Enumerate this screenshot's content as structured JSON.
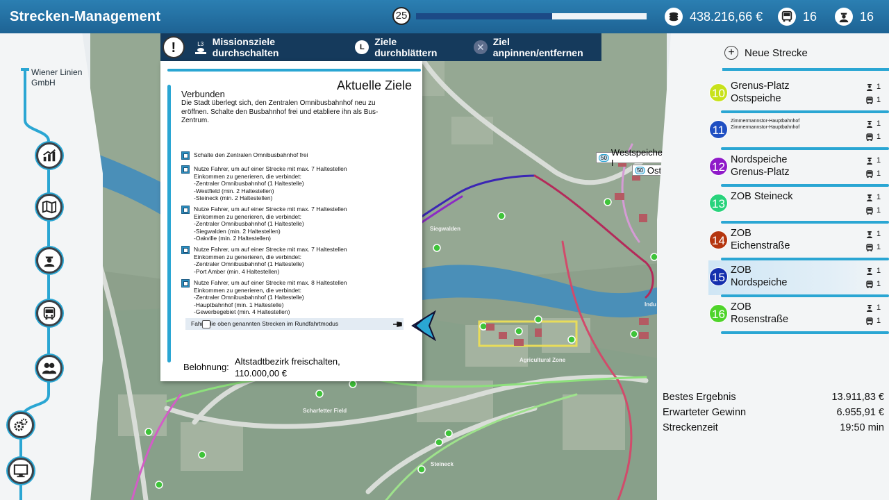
{
  "header": {
    "title": "Strecken-Management",
    "level": "25",
    "level_progress": 0.59,
    "money": "438.216,66 €",
    "buses": "16",
    "drivers": "16"
  },
  "company": {
    "name_line1": "Wiener Linien",
    "name_line2": "GmbH"
  },
  "sidebar": {
    "items": [
      {
        "icon": "statistics-icon"
      },
      {
        "icon": "map-icon"
      },
      {
        "icon": "driver-icon"
      },
      {
        "icon": "bus-icon"
      },
      {
        "icon": "staff-icon"
      },
      {
        "icon": "settings-gears-icon"
      },
      {
        "icon": "monitor-icon"
      }
    ]
  },
  "toolbar": {
    "alert_glyph": "!",
    "toggle_key": "L3",
    "toggle_label": "Missionsziele durchschalten",
    "browse_key": "L",
    "browse_label": "Ziele durchblättern",
    "pin_key": "✕",
    "pin_label": "Ziel anpinnen/entfernen"
  },
  "objectives": {
    "title": "Aktuelle Ziele",
    "subtitle": "Verbunden",
    "description": "Die Stadt überlegt sich, den Zentralen Omnibusbahnhof neu zu eröffnen. Schalte den Busbahnhof frei und etabliere ihn als Bus-Zentrum.",
    "tasks": [
      {
        "lines": [
          "Schalte den Zentralen Omnibusbahnhof frei"
        ]
      },
      {
        "lines": [
          "Nutze Fahrer, um auf einer Strecke mit max. 7 Haltestellen",
          "Einkommen zu generieren, die verbindet:",
          " -Zentraler Omnibusbahnhof (1 Haltestelle)",
          " -Westfield (min. 2 Haltestellen)",
          " -Steineck (min. 2 Haltestellen)"
        ]
      },
      {
        "lines": [
          "Nutze Fahrer, um auf einer Strecke mit max. 7 Haltestellen",
          "Einkommen zu generieren, die verbindet:",
          " -Zentraler Omnibusbahnhof (1 Haltestelle)",
          " -Siegwalden (min. 2 Haltestellen)",
          " -Oakville (min. 2 Haltestellen)"
        ]
      },
      {
        "lines": [
          "Nutze Fahrer, um auf einer Strecke mit max. 7 Haltestellen",
          "Einkommen zu generieren, die verbindet:",
          " -Zentraler Omnibusbahnhof (1 Haltestelle)",
          " -Port Amber (min. 4 Haltestellen)"
        ]
      },
      {
        "lines": [
          "Nutze Fahrer, um auf einer Strecke mit max. 8 Haltestellen",
          "Einkommen zu generieren, die verbindet:",
          " -Zentraler Omnibusbahnhof (1 Haltestelle)",
          " -Hauptbahnhof (min. 1 Haltestelle)",
          " -Gewerbegebiet (min. 4 Haltestellen)"
        ]
      }
    ],
    "final_task": "Fahre die oben genannten Strecken im Rundfahrtmodus",
    "reward_label": "Belohnung:",
    "reward_line1": "Altstadtbezirk freischalten,",
    "reward_line2": "110.000,00 €"
  },
  "map": {
    "labels": {
      "siegwalden": "Siegwalden",
      "agricultural": "Agricultural Zone",
      "scharfetter": "Scharfetter Field",
      "steineck": "Steineck",
      "industrial": "Indu"
    },
    "tags": [
      {
        "num": "50",
        "text": "Westspeiche I"
      },
      {
        "num": "50",
        "text": "Ostsp"
      }
    ]
  },
  "routes": {
    "new_route_label": "Neue Strecke",
    "items": [
      {
        "num": "10",
        "color": "#c8e21b",
        "line1": "Grenus-Platz",
        "line2": "Ostspeiche",
        "drivers": "1",
        "buses": "1",
        "small": false,
        "selected": false
      },
      {
        "num": "11",
        "color": "#1f4fc2",
        "line1": "Zimmermannstor-Hauptbahnhof",
        "line2": "Zimmermannstor-Hauptbahnhof",
        "drivers": "1",
        "buses": "1",
        "small": true,
        "selected": false
      },
      {
        "num": "12",
        "color": "#8f1ac9",
        "line1": "Nordspeiche",
        "line2": "Grenus-Platz",
        "drivers": "1",
        "buses": "1",
        "small": false,
        "selected": false
      },
      {
        "num": "13",
        "color": "#28d37c",
        "line1": "ZOB Steineck",
        "line2": "",
        "drivers": "1",
        "buses": "1",
        "small": false,
        "selected": false
      },
      {
        "num": "14",
        "color": "#b5360f",
        "line1": "ZOB",
        "line2": "Eichenstraße",
        "drivers": "1",
        "buses": "1",
        "small": false,
        "selected": false
      },
      {
        "num": "15",
        "color": "#142fae",
        "line1": "ZOB",
        "line2": "Nordspeiche",
        "drivers": "1",
        "buses": "1",
        "small": false,
        "selected": true
      },
      {
        "num": "16",
        "color": "#4fd42a",
        "line1": "ZOB",
        "line2": "Rosenstraße",
        "drivers": "1",
        "buses": "1",
        "small": false,
        "selected": false
      }
    ]
  },
  "stats": {
    "best_label": "Bestes Ergebnis",
    "best_value": "13.911,83 €",
    "expected_label": "Erwarteter Gewinn",
    "expected_value": "6.955,91 €",
    "time_label": "Streckenzeit",
    "time_value": "19:50 min"
  }
}
